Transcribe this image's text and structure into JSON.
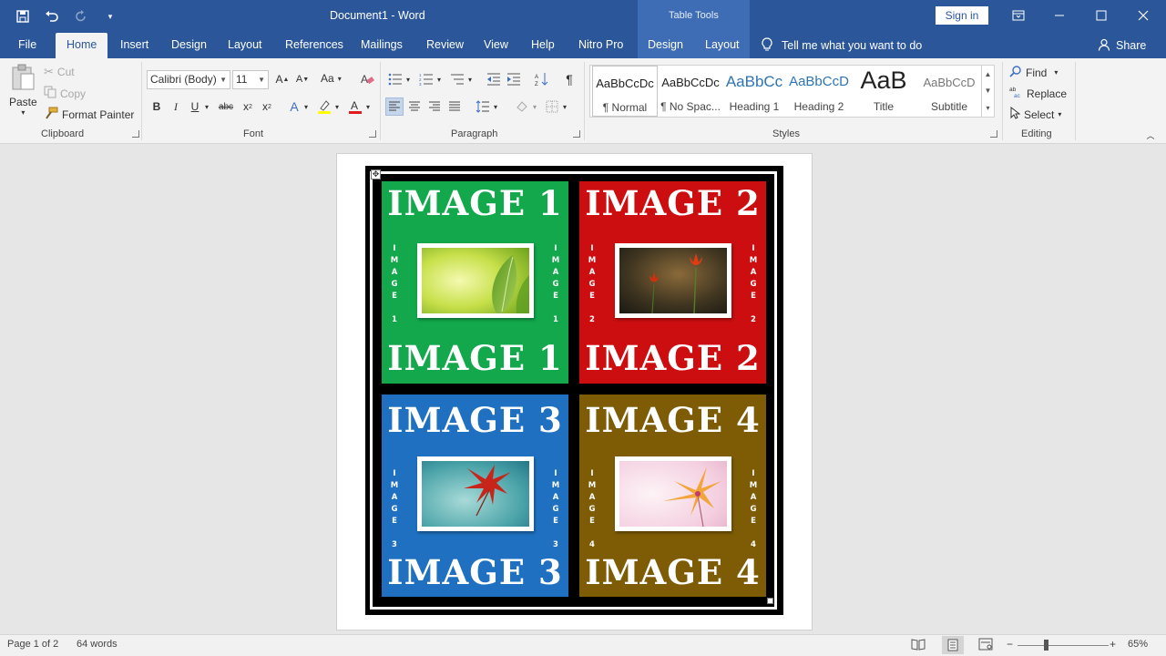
{
  "window": {
    "doc_title": "Document1  -  Word",
    "table_tools_label": "Table Tools",
    "sign_in": "Sign in"
  },
  "tabs": {
    "file": "File",
    "home": "Home",
    "insert": "Insert",
    "design": "Design",
    "layout": "Layout",
    "references": "References",
    "mailings": "Mailings",
    "review": "Review",
    "view": "View",
    "help": "Help",
    "nitro": "Nitro Pro",
    "tt_design": "Design",
    "tt_layout": "Layout",
    "tell_me": "Tell me what you want to do",
    "share": "Share"
  },
  "clipboard": {
    "paste": "Paste",
    "cut": "Cut",
    "copy": "Copy",
    "format_painter": "Format Painter",
    "label": "Clipboard"
  },
  "font": {
    "name": "Calibri (Body)",
    "size": "11",
    "change_case": "Aa",
    "label": "Font"
  },
  "paragraph": {
    "label": "Paragraph"
  },
  "styles": {
    "label": "Styles",
    "items": [
      {
        "preview": "AaBbCcDc",
        "name": "¶ Normal"
      },
      {
        "preview": "AaBbCcDc",
        "name": "¶ No Spac..."
      },
      {
        "preview": "AaBbCc",
        "name": "Heading 1"
      },
      {
        "preview": "AaBbCcD",
        "name": "Heading 2"
      },
      {
        "preview": "AaB",
        "name": "Title"
      },
      {
        "preview": "AaBbCcD",
        "name": "Subtitle"
      }
    ]
  },
  "editing": {
    "find": "Find",
    "replace": "Replace",
    "select": "Select",
    "label": "Editing"
  },
  "document": {
    "cells": [
      {
        "title": "IMAGE 1",
        "vertical": "IMAGE 1",
        "color": "#12a84b",
        "photo": "leaf"
      },
      {
        "title": "IMAGE 2",
        "vertical": "IMAGE 2",
        "color": "#cc0e10",
        "photo": "tulips"
      },
      {
        "title": "IMAGE 3",
        "vertical": "IMAGE 3",
        "color": "#1f70c0",
        "photo": "flower-blue"
      },
      {
        "title": "IMAGE 4",
        "vertical": "IMAGE 4",
        "color": "#7e5c06",
        "photo": "flower-pink"
      }
    ]
  },
  "status": {
    "page": "Page 1 of 2",
    "words": "64 words",
    "zoom": "65%"
  }
}
